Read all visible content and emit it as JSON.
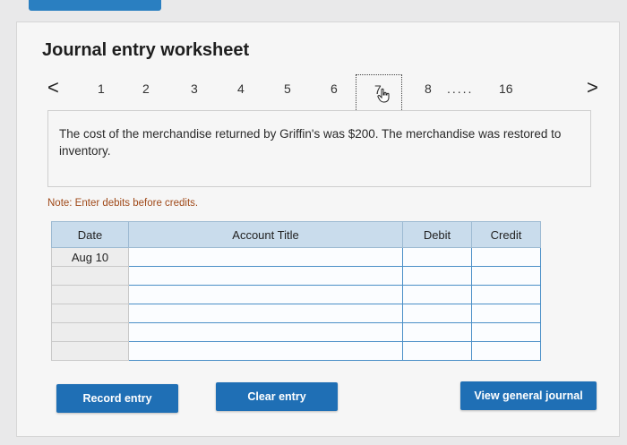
{
  "worksheet": {
    "title": "Journal entry worksheet",
    "pager": {
      "prev_label": "<",
      "next_label": ">",
      "pages": [
        "1",
        "2",
        "3",
        "4",
        "5",
        "6"
      ],
      "current": "7",
      "after_current": "8",
      "ellipsis": ".....",
      "last": "16"
    },
    "description": "The cost of the merchandise returned by Griffin's was $200. The merchandise was restored to inventory.",
    "note": "Note: Enter debits before credits.",
    "table": {
      "headers": [
        "Date",
        "Account Title",
        "Debit",
        "Credit"
      ],
      "rows": [
        {
          "date": "Aug 10",
          "account": "",
          "debit": "",
          "credit": ""
        },
        {
          "date": "",
          "account": "",
          "debit": "",
          "credit": ""
        },
        {
          "date": "",
          "account": "",
          "debit": "",
          "credit": ""
        },
        {
          "date": "",
          "account": "",
          "debit": "",
          "credit": ""
        },
        {
          "date": "",
          "account": "",
          "debit": "",
          "credit": ""
        },
        {
          "date": "",
          "account": "",
          "debit": "",
          "credit": ""
        }
      ]
    },
    "buttons": {
      "record": "Record entry",
      "clear": "Clear entry",
      "view_journal": "View general journal"
    }
  },
  "colors": {
    "button_blue": "#1f6fb5",
    "header_bg": "#c9dcec",
    "note_color": "#a04a1a"
  },
  "icons": {
    "cursor": "hand-pointer-icon"
  }
}
